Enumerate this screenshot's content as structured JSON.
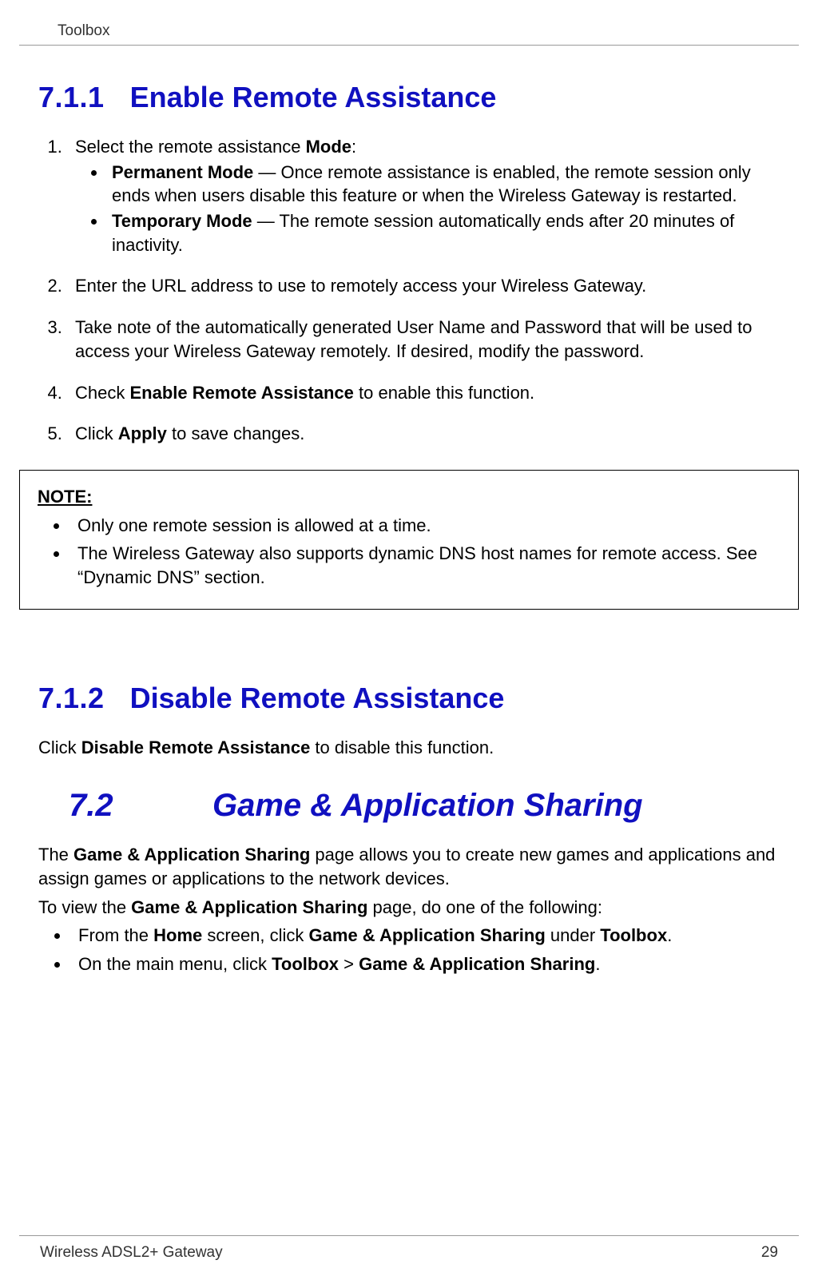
{
  "header": {
    "title": "Toolbox"
  },
  "section_711": {
    "number": "7.1.1",
    "title": "Enable Remote Assistance",
    "step1_prefix": "Select the remote assistance ",
    "step1_bold": "Mode",
    "step1_suffix": ":",
    "perm_label": "Permanent Mode",
    "perm_text": " — Once remote assistance is enabled, the remote session only ends when users disable this feature or when the Wireless Gateway is restarted.",
    "temp_label": "Temporary Mode",
    "temp_text": " — The remote session automatically ends after 20 minutes of inactivity.",
    "step2": "Enter the URL address to use to remotely access your Wireless Gateway.",
    "step3": "Take note of the automatically generated User Name and Password that will be used to access your Wireless Gateway remotely. If desired, modify the password.",
    "step4_prefix": "Check ",
    "step4_bold": "Enable Remote Assistance",
    "step4_suffix": " to enable this function.",
    "step5_prefix": "Click ",
    "step5_bold": "Apply",
    "step5_suffix": " to save changes."
  },
  "note": {
    "heading": "NOTE:",
    "item1": "Only one remote session is allowed at a time.",
    "item2": "The Wireless Gateway also supports dynamic DNS host names for remote access. See “Dynamic DNS” section."
  },
  "section_712": {
    "number": "7.1.2",
    "title": "Disable Remote Assistance",
    "p_prefix": "Click ",
    "p_bold": "Disable Remote Assistance",
    "p_suffix": " to disable this function."
  },
  "section_72": {
    "number": "7.2",
    "title": "Game & Application Sharing",
    "p1a": "The ",
    "p1b": "Game & Application Sharing",
    "p1c": " page allows you to create new games and applications and assign games or applications to the network devices.",
    "p2a": "To view the ",
    "p2b": "Game & Application Sharing",
    "p2c": " page, do one of the following:",
    "li1a": "From the ",
    "li1b": "Home",
    "li1c": " screen, click ",
    "li1d": "Game & Application Sharing",
    "li1e": " under ",
    "li1f": "Toolbox",
    "li1g": ".",
    "li2a": "On the main menu, click ",
    "li2b": "Toolbox",
    "li2c": " > ",
    "li2d": "Game & Application Sharing",
    "li2e": "."
  },
  "footer": {
    "product": "Wireless ADSL2+ Gateway",
    "page": "29"
  }
}
